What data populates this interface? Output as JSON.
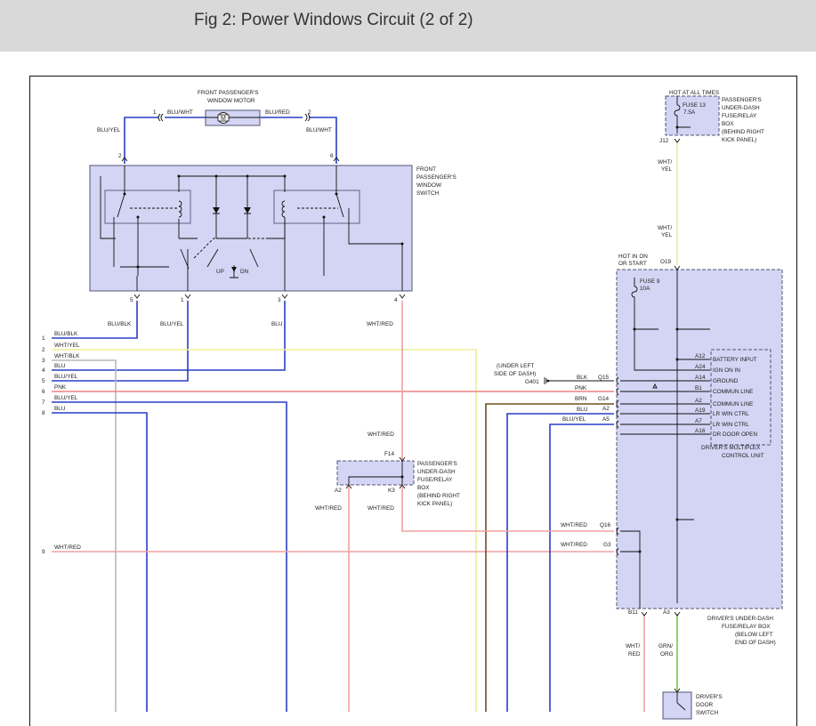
{
  "header": {
    "title": "Fig 2: Power Windows Circuit (2 of 2)"
  },
  "colors": {
    "blu": "#2a3ec6",
    "wht_yel": "#eeee99",
    "wht_red": "#f0a0a0",
    "pnk": "#f08080",
    "brn": "#6a5020",
    "wht_blk": "#b8b8b8",
    "grn_org": "#7acc3a",
    "component_fill": "#d4d4f4"
  },
  "components": {
    "motor": {
      "title_1": "FRONT PASSENGER'S",
      "title_2": "WINDOW MOTOR",
      "symbol": "M"
    },
    "pass_switch": {
      "line_1": "FRONT",
      "line_2": "PASSENGER'S",
      "line_3": "WINDOW",
      "line_4": "SWITCH",
      "up": "UP",
      "dn": "DN"
    },
    "fuse13_box": {
      "hot_label": "HOT AT ALL TIMES",
      "fuse_name": "FUSE 13",
      "fuse_rating": "7.5A",
      "line_1": "PASSENGER'S",
      "line_2": "UNDER-DASH",
      "line_3": "FUSE/RELAY",
      "line_4": "BOX",
      "line_5": "(BEHIND RIGHT",
      "line_6": "KICK PANEL)",
      "pin": "J12"
    },
    "fuse9": {
      "hot_1": "HOT IN ON",
      "hot_2": "OR START",
      "fuse_name": "FUSE 9",
      "fuse_rating": "10A",
      "pin": "O19"
    },
    "mpcu": {
      "title_1": "DRIVER'S MULTIPLEX",
      "title_2": "CONTROL UNIT",
      "labels": [
        "BATTERY INPUT",
        "IGN ON IN",
        "GROUND",
        "COMMUN LINE",
        "COMMUN LINE",
        "LR WIN CTRL",
        "LR WIN CTRL",
        "DR DOOR OPEN"
      ],
      "pins": [
        "A12",
        "A24",
        "A14",
        "B1",
        "A2",
        "A19",
        "A7",
        "A16"
      ]
    },
    "pass_fuse_box": {
      "line_1": "PASSENGER'S",
      "line_2": "UNDER-DASH",
      "line_3": "FUSE/RELAY",
      "line_4": "BOX",
      "line_5": "(BEHIND RIGHT",
      "line_6": "KICK PANEL)",
      "pin_top": "F14",
      "pin_a2": "A2",
      "pin_k3": "K3"
    },
    "driver_box": {
      "line_1": "DRIVER'S UNDER-DASH",
      "line_2": "FUSE/RELAY BOX",
      "line_3": "(BELOW LEFT",
      "line_4": "END OF DASH)",
      "pin_b11": "B11",
      "pin_a3": "A3"
    },
    "door_switch": {
      "line_1": "DRIVER'S",
      "line_2": "DOOR",
      "line_3": "SWITCH"
    },
    "ground": {
      "line_1": "(UNDER LEFT",
      "line_2": "SIDE OF DASH)",
      "name": "G401"
    }
  },
  "wires": {
    "motor_left": "BLU/WHT",
    "motor_right": "BLU/RED",
    "motor_right_down": "BLU/WHT",
    "switch_left_in": "BLU/YEL",
    "fuse13_out_1": "WHT/",
    "fuse13_out_2": "YEL",
    "fuse13_out_3": "WHT/",
    "fuse13_out_4": "YEL",
    "sw5": "BLU/BLK",
    "sw1": "BLU/YEL",
    "sw3": "BLU",
    "sw4": "WHT/RED",
    "mpcu_blk": "BLK",
    "mpcu_pnk": "PNK",
    "mpcu_brn": "BRN",
    "mpcu_blu": "BLU",
    "mpcu_bluyel": "BLU/YEL",
    "whtred_mid": "WHT/RED",
    "a2_wire": "WHT/RED",
    "k3_wire": "WHT/RED",
    "q16_wire": "WHT/RED",
    "g3_wire": "WHT/RED",
    "b11_1": "WHT/",
    "b11_2": "RED",
    "a3_1": "GRN/",
    "a3_2": "ORG"
  },
  "pins": {
    "motor_l": "1",
    "motor_r": "2",
    "sw_2": "2",
    "sw_6": "6",
    "sw_5": "5",
    "sw_1": "1",
    "sw_3": "3",
    "sw_4": "4",
    "q15": "Q15",
    "g14": "G14",
    "a2": "A2",
    "a5": "A5",
    "q16": "Q16",
    "g3": "G3"
  },
  "harness": {
    "rows": [
      {
        "num": "1",
        "label": "BLU/BLK"
      },
      {
        "num": "2",
        "label": "WHT/YEL"
      },
      {
        "num": "3",
        "label": "WHT/BLK"
      },
      {
        "num": "4",
        "label": "BLU"
      },
      {
        "num": "5",
        "label": "BLU/YEL"
      },
      {
        "num": "6",
        "label": "PNK"
      },
      {
        "num": "7",
        "label": "BLU/YEL"
      },
      {
        "num": "8",
        "label": "BLU"
      },
      {
        "num": "9",
        "label": "WHT/RED"
      }
    ]
  }
}
